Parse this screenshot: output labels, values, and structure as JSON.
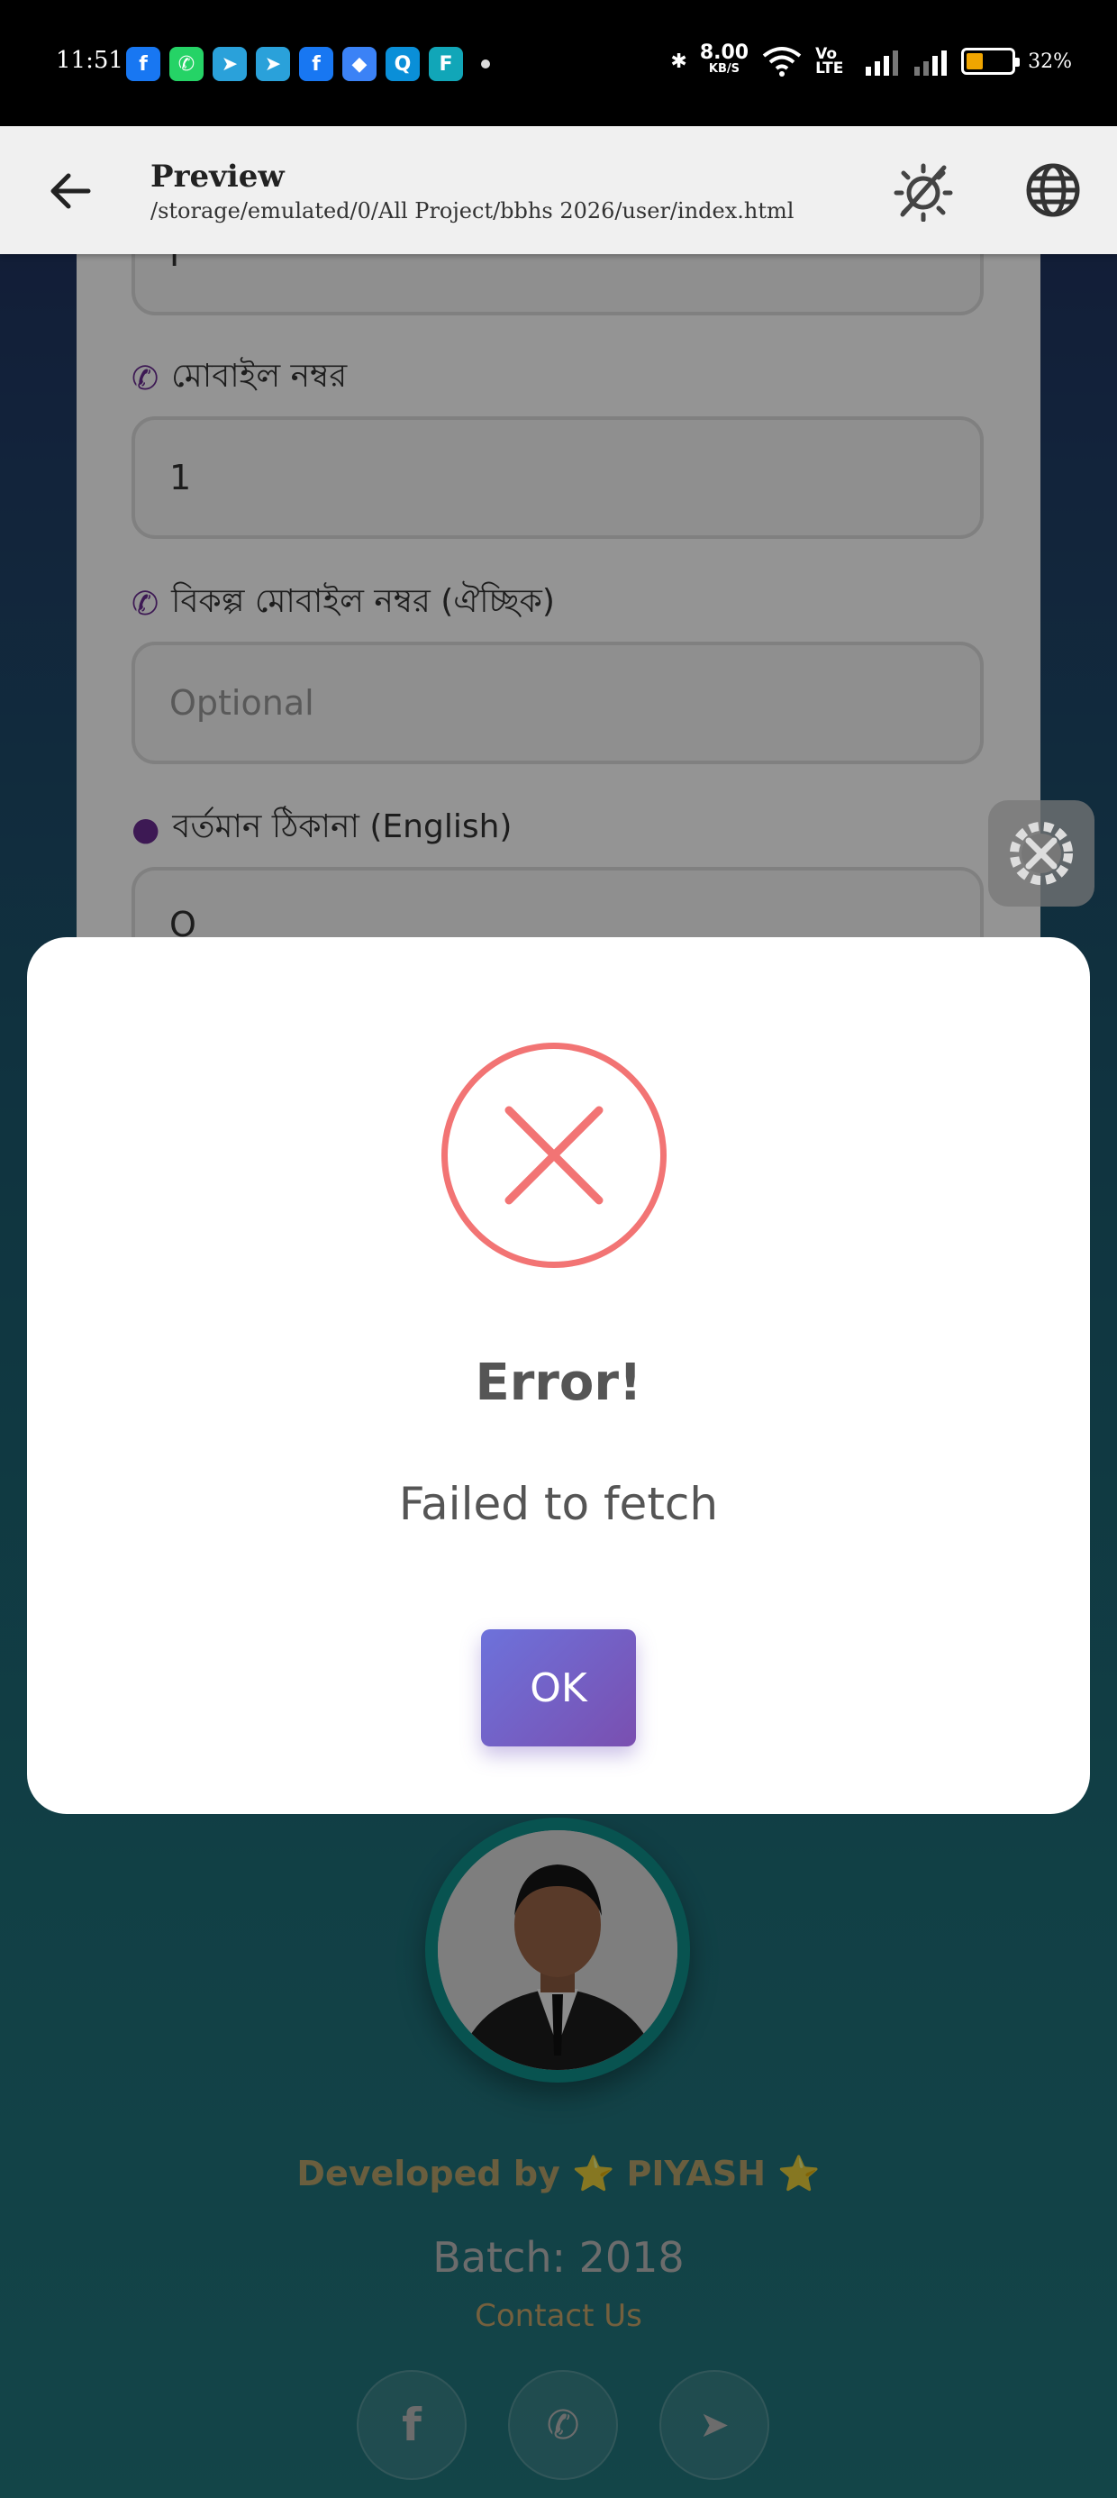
{
  "statusbar": {
    "time": "11:51",
    "net_speed": "8.00",
    "net_unit": "KB/S",
    "volte": "Vo LTE",
    "battery": "32%"
  },
  "appbar": {
    "title": "Preview",
    "path": "/storage/emulated/0/All Project/bbhs 2026/user/index.html"
  },
  "form": {
    "prev_value": "I",
    "mobile_label": "মোবাইল নম্বর",
    "mobile_value": "1",
    "alt_mobile_label": "বিকল্প মোবাইল নম্বর (ঐচ্ছিক)",
    "alt_mobile_placeholder": "Optional",
    "address_label": "বর্তমান ঠিকানা (English)",
    "address_value": "O"
  },
  "dialog": {
    "title": "Error!",
    "message": "Failed to fetch",
    "ok_label": "OK",
    "error_color": "#f27474"
  },
  "footer": {
    "developed_by": "Developed by ⭐ PIYASH ⭐",
    "batch": "Batch: 2018",
    "contact": "Contact Us",
    "socials": [
      "facebook-icon",
      "whatsapp-icon",
      "telegram-icon"
    ]
  },
  "colors": {
    "accent_purple": "#6a2c91",
    "ok_gradient_start": "#6d72db",
    "ok_gradient_end": "#7a4fb0"
  }
}
